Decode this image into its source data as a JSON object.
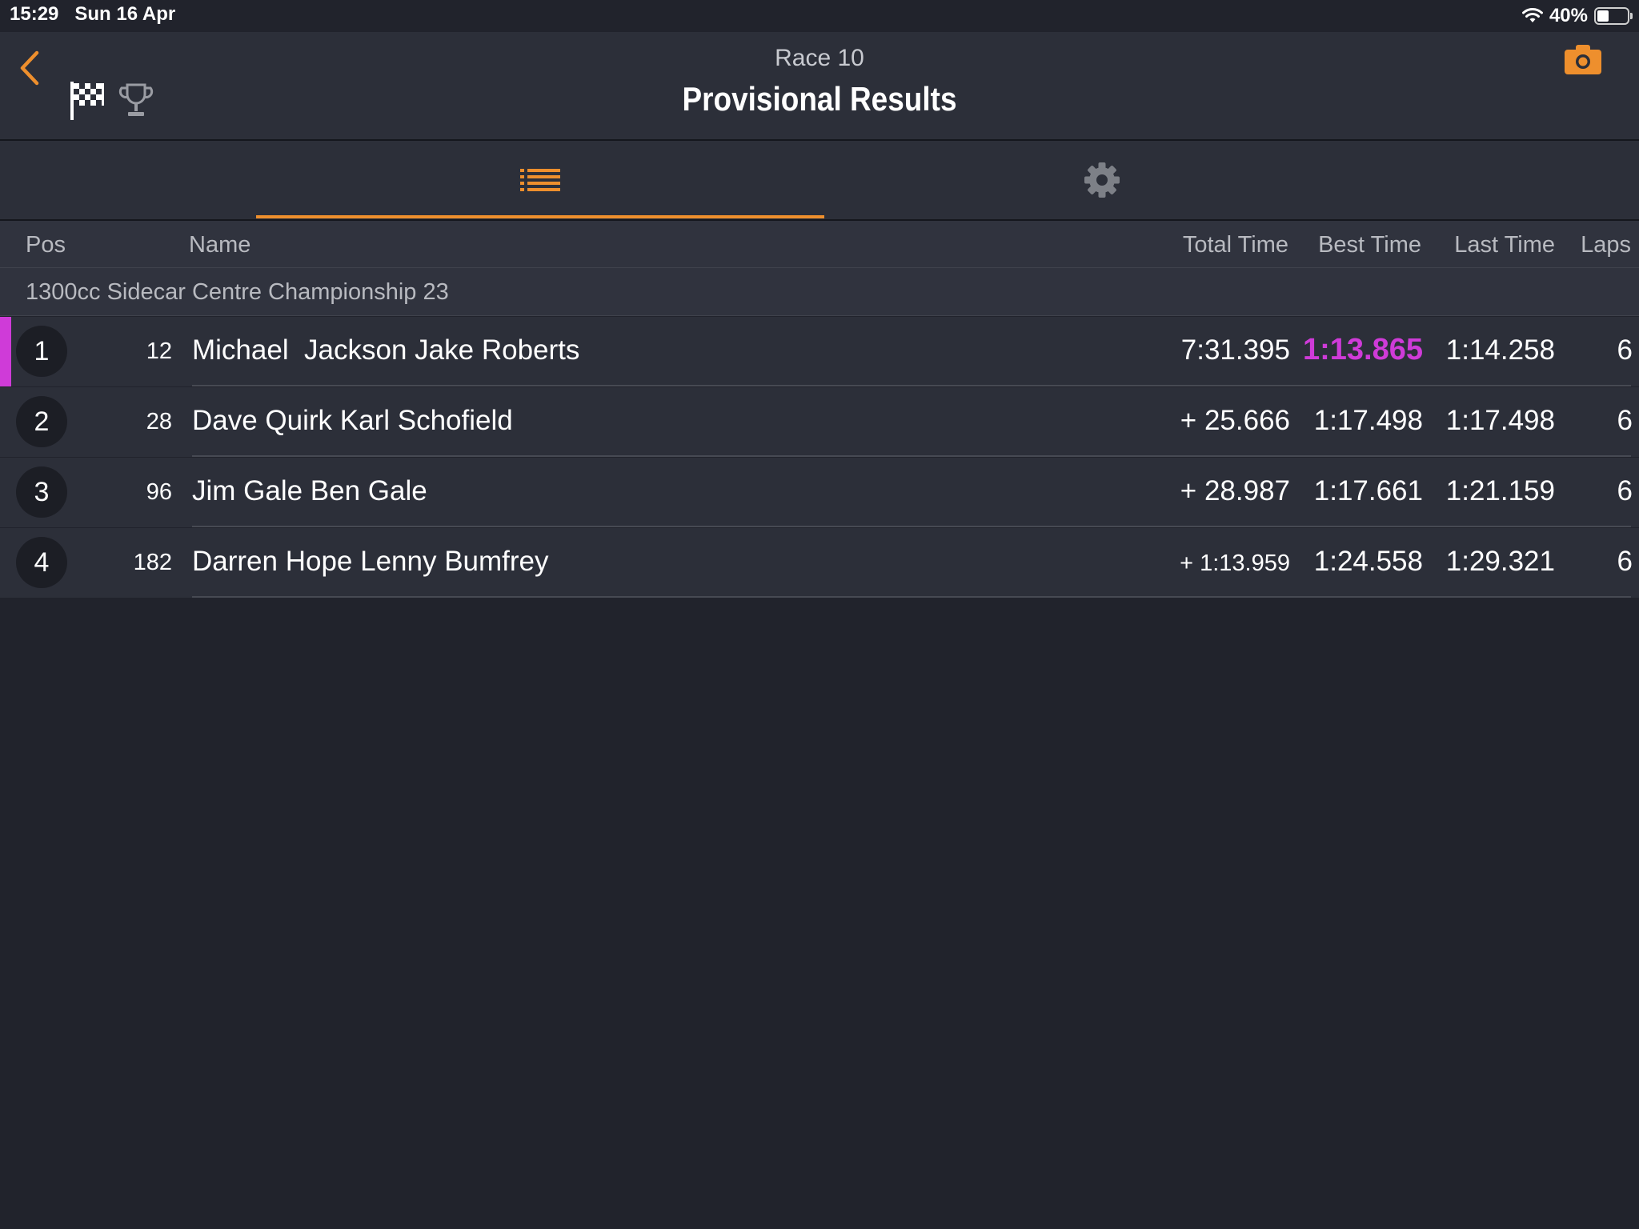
{
  "status_bar": {
    "time": "15:29   Sun 16 Apr",
    "battery": "40%",
    "battery_level": 0.4
  },
  "header": {
    "subtitle": "Race 10",
    "title": "Provisional Results"
  },
  "table": {
    "columns": {
      "pos": "Pos",
      "name": "Name",
      "total": "Total Time",
      "best": "Best Time",
      "last": "Last Time",
      "laps": "Laps"
    },
    "group": "1300cc Sidecar Centre Championship 23",
    "rows": [
      {
        "pos": "1",
        "number": "12",
        "name": "Michael  Jackson Jake Roberts",
        "total": "7:31.395",
        "best": "1:13.865",
        "last": "1:14.258",
        "laps": "6"
      },
      {
        "pos": "2",
        "number": "28",
        "name": "Dave Quirk Karl Schofield",
        "total": "+ 25.666",
        "best": "1:17.498",
        "last": "1:17.498",
        "laps": "6"
      },
      {
        "pos": "3",
        "number": "96",
        "name": "Jim Gale Ben Gale",
        "total": "+ 28.987",
        "best": "1:17.661",
        "last": "1:21.159",
        "laps": "6"
      },
      {
        "pos": "4",
        "number": "182",
        "name": "Darren Hope Lenny Bumfrey",
        "total": "+ 1:13.959",
        "best": "1:24.558",
        "last": "1:29.321",
        "laps": "6"
      }
    ]
  },
  "colors": {
    "accent": "#ee8f2d",
    "fastest_lap": "#cf3bd8",
    "background": "#21232c"
  }
}
